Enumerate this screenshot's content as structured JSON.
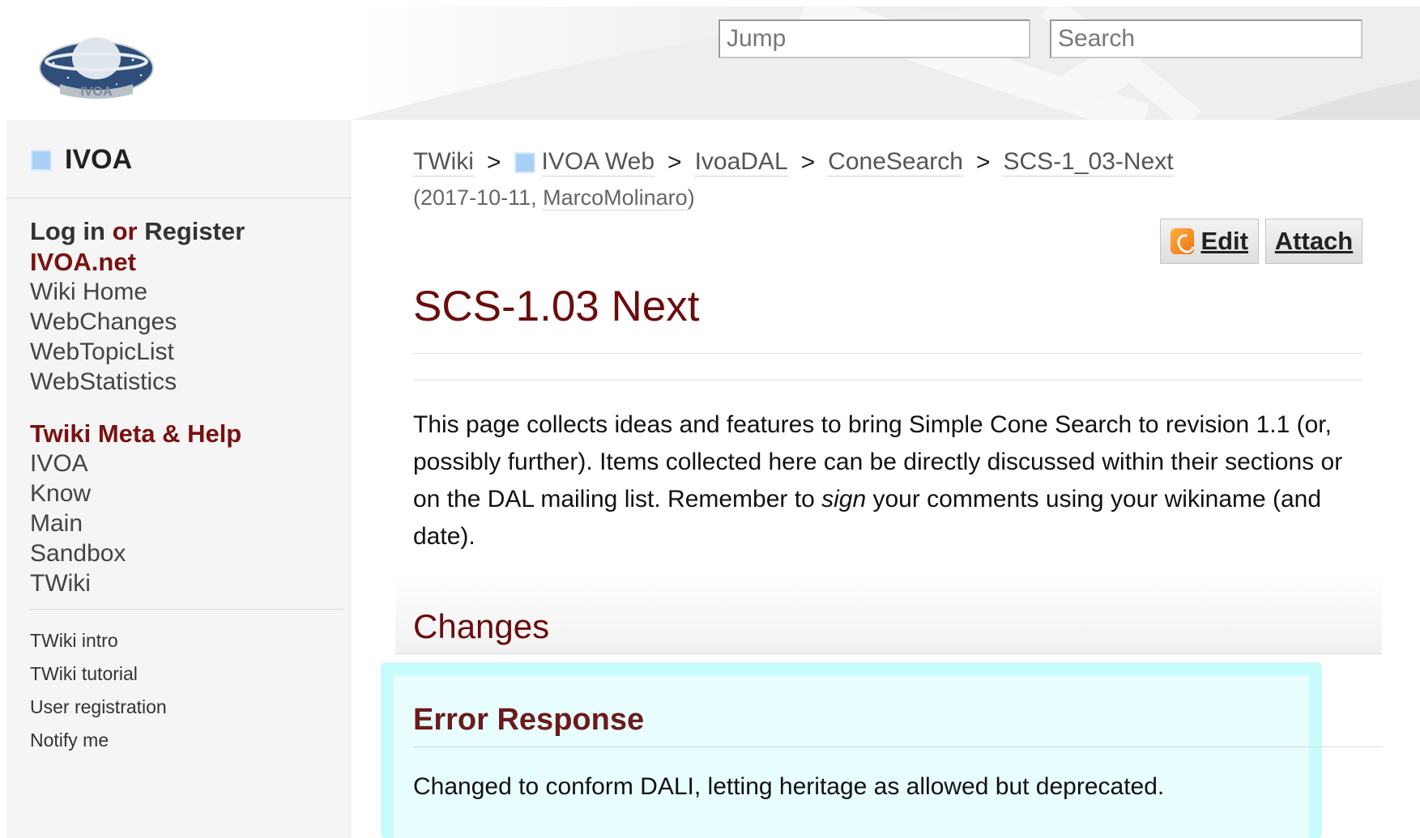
{
  "header": {
    "logo_text": "IVOA",
    "jump_placeholder": "Jump",
    "search_placeholder": "Search"
  },
  "sidebar": {
    "web_name": "IVOA",
    "login": {
      "login_label": "Log in",
      "or_label": "or",
      "register_label": "Register"
    },
    "sections": [
      {
        "heading": "IVOA.net",
        "links": [
          "Wiki Home",
          "WebChanges",
          "WebTopicList",
          "WebStatistics"
        ]
      },
      {
        "heading": "Twiki Meta & Help",
        "links": [
          "IVOA",
          "Know",
          "Main",
          "Sandbox",
          "TWiki"
        ]
      }
    ],
    "small_links": [
      "TWiki intro",
      "TWiki tutorial",
      "User registration",
      "Notify me"
    ]
  },
  "breadcrumb": {
    "items": [
      "TWiki",
      "IVOA Web",
      "IvoaDAL",
      "ConeSearch",
      "SCS-1_03-Next"
    ],
    "separator": ">"
  },
  "revision": {
    "date": "2017-10-11",
    "author": "MarcoMolinaro"
  },
  "toolbar": {
    "edit_label": "Edit",
    "attach_label": "Attach"
  },
  "page": {
    "title": "SCS-1.03 Next",
    "intro_before_sign": "This page collects ideas and features to bring Simple Cone Search to revision 1.1 (or, possibly further). Items collected here can be directly discussed within their sections or on the DAL mailing list. Remember to ",
    "intro_emph": "sign",
    "intro_after_sign": " your comments using your wikiname (and date).",
    "changes_heading": "Changes",
    "error_heading": "Error Response",
    "error_text": "Changed to conform DALI, letting heritage as allowed but deprecated."
  },
  "colors": {
    "accent": "#6b0b0b",
    "highlight": "#c8fbfb",
    "web_icon": "#a8d0f5"
  }
}
